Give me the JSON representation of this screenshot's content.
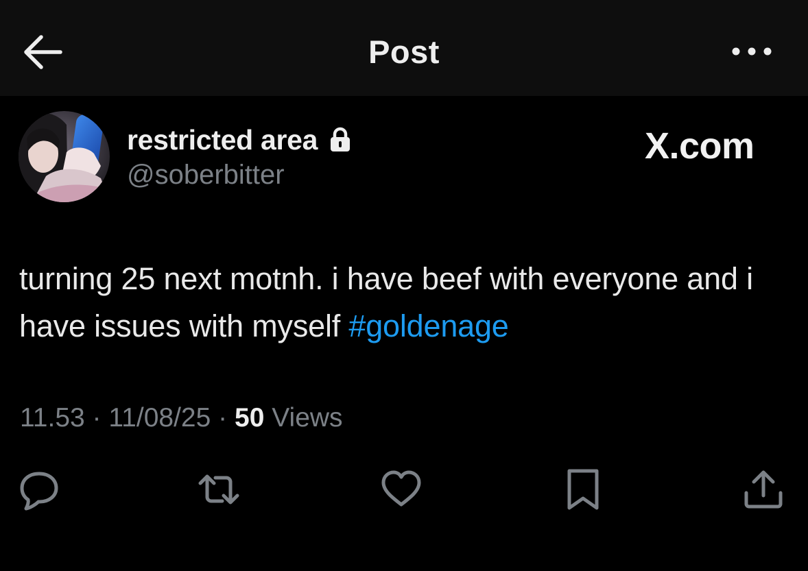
{
  "header": {
    "back_icon": "arrow-left-icon",
    "title": "Post",
    "more_icon": "more-horizontal-icon"
  },
  "author": {
    "display_name": "restricted area",
    "protected_icon": "lock-icon",
    "handle": "@soberbitter",
    "avatar": "avatar-photo"
  },
  "watermark": "X.com",
  "post": {
    "text": "turning 25 next motnh. i have beef with everyone and i have issues with myself ",
    "hashtag": "#goldenage"
  },
  "meta": {
    "time": "11.53",
    "separator": "·",
    "date": "11/08/25",
    "views_count": "50",
    "views_label": "Views"
  },
  "actions": [
    {
      "name": "reply",
      "icon": "reply-icon"
    },
    {
      "name": "repost",
      "icon": "repost-icon"
    },
    {
      "name": "like",
      "icon": "heart-icon"
    },
    {
      "name": "bookmark",
      "icon": "bookmark-icon"
    },
    {
      "name": "share",
      "icon": "share-icon"
    }
  ],
  "colors": {
    "background": "#000000",
    "header_background": "#0e0e0e",
    "text_primary": "#e9e9e9",
    "text_secondary": "#7c8187",
    "link": "#1d9bf0",
    "icon": "#7c8187"
  }
}
